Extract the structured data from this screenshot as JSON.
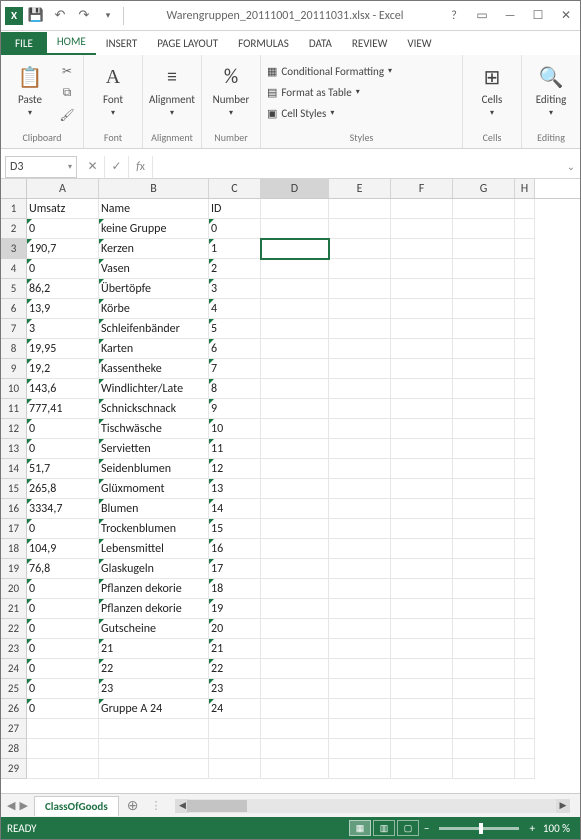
{
  "title": "Warengruppen_20111001_20111031.xlsx - Excel",
  "tabs": {
    "file": "FILE",
    "home": "HOME",
    "insert": "INSERT",
    "pagelayout": "PAGE LAYOUT",
    "formulas": "FORMULAS",
    "data": "DATA",
    "review": "REVIEW",
    "view": "VIEW"
  },
  "ribbon": {
    "clipboard": {
      "paste": "Paste",
      "label": "Clipboard"
    },
    "font": {
      "label": "Font",
      "big": "Font"
    },
    "alignment": {
      "label": "Alignment",
      "big": "Alignment"
    },
    "number": {
      "label": "Number",
      "big": "Number"
    },
    "styles": {
      "cond": "Conditional Formatting",
      "table": "Format as Table",
      "cell": "Cell Styles",
      "label": "Styles"
    },
    "cells": {
      "big": "Cells",
      "label": "Cells"
    },
    "editing": {
      "big": "Editing",
      "label": "Editing"
    }
  },
  "namebox": "D3",
  "formula": "",
  "columns": [
    "A",
    "B",
    "C",
    "D",
    "E",
    "F",
    "G",
    "H"
  ],
  "active_cell": {
    "row": 3,
    "col": "D"
  },
  "selected_col": "D",
  "selected_row": 3,
  "sheet_tab": "ClassOfGoods",
  "status": "READY",
  "zoom": "100 %",
  "headers": {
    "A": "Umsatz",
    "B": "Name",
    "C": "ID"
  },
  "rows": [
    {
      "n": 1,
      "A": "Umsatz",
      "B": "Name",
      "C": "ID",
      "noTri": true
    },
    {
      "n": 2,
      "A": "0",
      "B": "keine Gruppe",
      "C": "0"
    },
    {
      "n": 3,
      "A": "190,7",
      "B": "Kerzen",
      "C": "1"
    },
    {
      "n": 4,
      "A": "0",
      "B": "Vasen",
      "C": "2"
    },
    {
      "n": 5,
      "A": "86,2",
      "B": "Übertöpfe",
      "C": "3"
    },
    {
      "n": 6,
      "A": "13,9",
      "B": "Körbe",
      "C": "4"
    },
    {
      "n": 7,
      "A": "3",
      "B": "Schleifenbänder",
      "C": "5"
    },
    {
      "n": 8,
      "A": "19,95",
      "B": "Karten",
      "C": "6"
    },
    {
      "n": 9,
      "A": "19,2",
      "B": "Kassentheke",
      "C": "7"
    },
    {
      "n": 10,
      "A": "143,6",
      "B": "Windlichter/Late",
      "C": "8"
    },
    {
      "n": 11,
      "A": "777,41",
      "B": "Schnickschnack",
      "C": "9"
    },
    {
      "n": 12,
      "A": "0",
      "B": "Tischwäsche",
      "C": "10"
    },
    {
      "n": 13,
      "A": "0",
      "B": "Servietten",
      "C": "11"
    },
    {
      "n": 14,
      "A": "51,7",
      "B": "Seidenblumen",
      "C": "12"
    },
    {
      "n": 15,
      "A": "265,8",
      "B": "Glüxmoment",
      "C": "13"
    },
    {
      "n": 16,
      "A": "3334,7",
      "B": "Blumen",
      "C": "14"
    },
    {
      "n": 17,
      "A": "0",
      "B": "Trockenblumen",
      "C": "15"
    },
    {
      "n": 18,
      "A": "104,9",
      "B": "Lebensmittel",
      "C": "16"
    },
    {
      "n": 19,
      "A": "76,8",
      "B": "Glaskugeln",
      "C": "17"
    },
    {
      "n": 20,
      "A": "0",
      "B": "Pflanzen dekorie",
      "C": "18"
    },
    {
      "n": 21,
      "A": "0",
      "B": "Pflanzen dekorie",
      "C": "19"
    },
    {
      "n": 22,
      "A": "0",
      "B": "Gutscheine",
      "C": "20"
    },
    {
      "n": 23,
      "A": "0",
      "B": "21",
      "C": "21"
    },
    {
      "n": 24,
      "A": "0",
      "B": "22",
      "C": "22"
    },
    {
      "n": 25,
      "A": "0",
      "B": "23",
      "C": "23"
    },
    {
      "n": 26,
      "A": "0",
      "B": "Gruppe A 24",
      "C": "24"
    },
    {
      "n": 27,
      "A": "",
      "B": "",
      "C": "",
      "noTri": true
    },
    {
      "n": 28,
      "A": "",
      "B": "",
      "C": "",
      "noTri": true
    },
    {
      "n": 29,
      "A": "",
      "B": "",
      "C": "",
      "noTri": true
    }
  ]
}
